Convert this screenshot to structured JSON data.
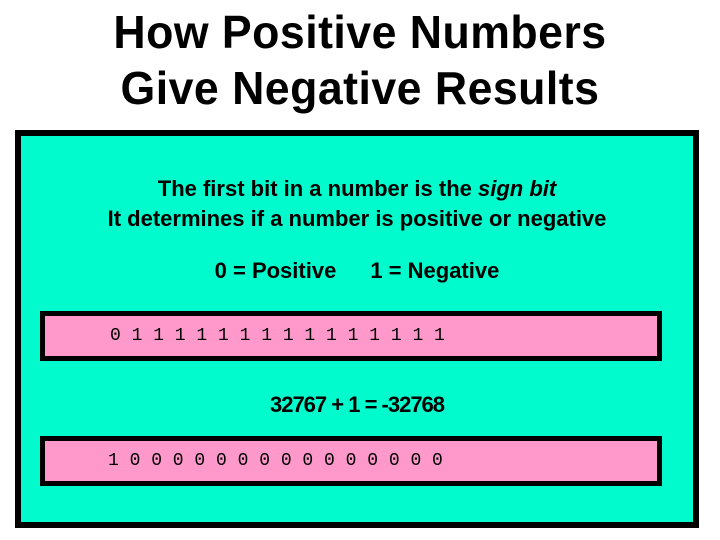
{
  "title": {
    "line1": "How Positive Numbers",
    "line2": "Give Negative Results"
  },
  "panel": {
    "line1_prefix": "The first bit in a number is the ",
    "line1_emphasis": "sign bit",
    "line2": "It determines if a number is positive or negative",
    "legend_positive": "0 = Positive",
    "legend_negative": "1 = Negative",
    "bits_max_positive": "0 1 1 1 1 1 1 1 1 1 1 1 1 1 1 1",
    "equation": "32767 + 1 = -32768",
    "bits_result": "1 0 0 0 0 0 0 0 0 0 0 0 0 0 0 0"
  },
  "colors": {
    "panel_bg": "#02fbcc",
    "bit_box_bg": "#ff99cc",
    "border": "#000000"
  }
}
